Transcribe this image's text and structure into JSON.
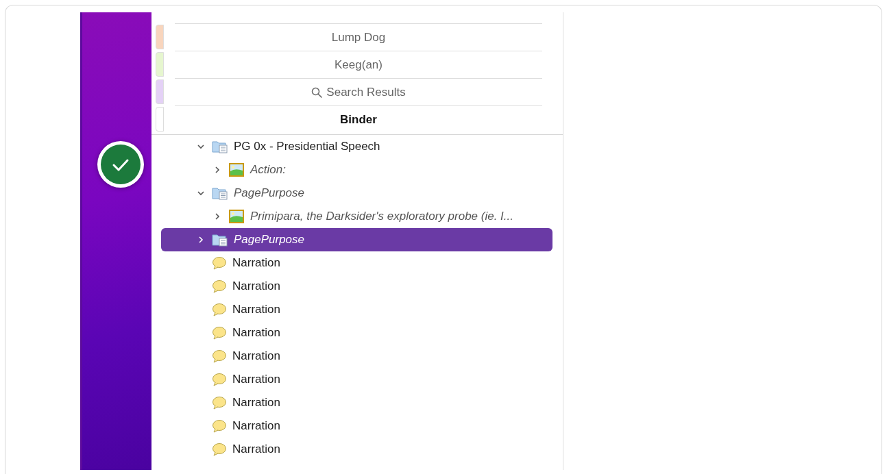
{
  "tabs": [
    {
      "label": "Lump Dog",
      "color": "#f8d5bd",
      "selected": false,
      "kind": "text"
    },
    {
      "label": "Keeg(an)",
      "color": "#e6f6cf",
      "selected": false,
      "kind": "text"
    },
    {
      "label": "Search Results",
      "color": "#e4d1f6",
      "selected": false,
      "kind": "search"
    },
    {
      "label": "Binder",
      "color": "#ffffff",
      "selected": true,
      "kind": "text"
    }
  ],
  "binder": [
    {
      "title": "PG 0x - Presidential Speech",
      "kind": "folder",
      "italic": false,
      "expanded": true,
      "selected": false,
      "children": [
        {
          "title": "Action:",
          "kind": "image",
          "italic": true,
          "expanded": false,
          "selected": false
        }
      ]
    },
    {
      "title": "PagePurpose",
      "kind": "folder",
      "italic": true,
      "expanded": true,
      "selected": false,
      "children": [
        {
          "title": "Primipara, the Darksider's exploratory probe (ie. I...",
          "kind": "image",
          "italic": true,
          "expanded": false,
          "selected": false
        }
      ]
    },
    {
      "title": "PagePurpose",
      "kind": "folder",
      "italic": true,
      "expanded": false,
      "selected": true
    },
    {
      "title": "Narration",
      "kind": "note",
      "italic": false,
      "selected": false
    },
    {
      "title": "Narration",
      "kind": "note",
      "italic": false,
      "selected": false
    },
    {
      "title": "Narration",
      "kind": "note",
      "italic": false,
      "selected": false
    },
    {
      "title": "Narration",
      "kind": "note",
      "italic": false,
      "selected": false
    },
    {
      "title": "Narration",
      "kind": "note",
      "italic": false,
      "selected": false
    },
    {
      "title": "Narration",
      "kind": "note",
      "italic": false,
      "selected": false
    },
    {
      "title": "Narration",
      "kind": "note",
      "italic": false,
      "selected": false
    },
    {
      "title": "Narration",
      "kind": "note",
      "italic": false,
      "selected": false
    },
    {
      "title": "Narration",
      "kind": "note",
      "italic": false,
      "selected": false
    }
  ]
}
